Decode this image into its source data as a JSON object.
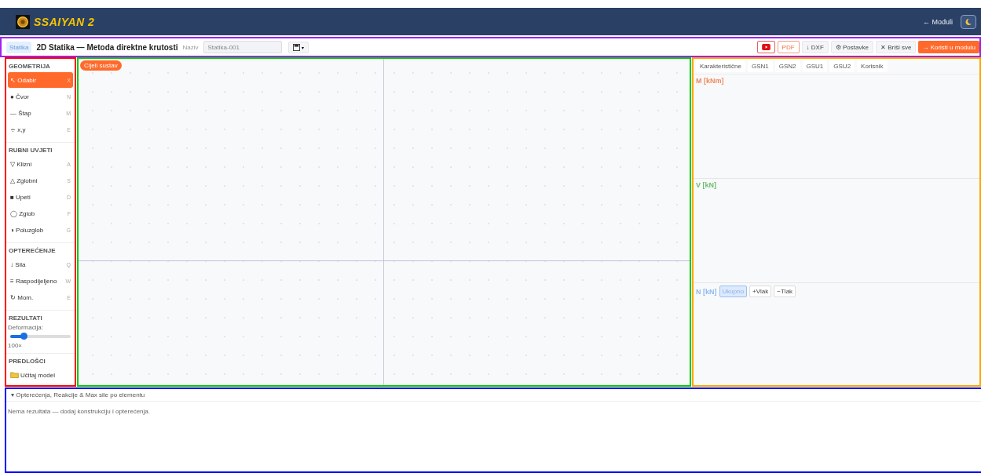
{
  "header": {
    "brand": "SSAIYAN 2",
    "back_link": "← Moduli"
  },
  "toolbar": {
    "tag": "Statika",
    "title": "2D Statika — Metoda direktne krutosti",
    "name_label": "Naziv",
    "name_value": "Statika-001",
    "save_caret": "▾",
    "buttons": [
      {
        "kind": "video"
      },
      {
        "kind": "outline",
        "label": "PDF"
      },
      {
        "kind": "plain",
        "label": "↓ DXF"
      },
      {
        "kind": "plain",
        "label": "⚙ Postavke"
      },
      {
        "kind": "plain",
        "label": "✕ Briši sve"
      },
      {
        "kind": "primary",
        "label": "→ Koristi u modulu"
      }
    ]
  },
  "sidebar": {
    "sections": [
      {
        "title": "GEOMETRIJA",
        "items": [
          {
            "icon": "↖",
            "label": "Odabir",
            "key": "X",
            "selected": true
          },
          {
            "icon": "●",
            "label": "Čvor",
            "key": "N",
            "selected": false
          },
          {
            "icon": "—",
            "label": "Štap",
            "key": "M",
            "selected": false
          },
          {
            "icon": "∻",
            "label": "x,y",
            "key": "E",
            "selected": false
          }
        ]
      },
      {
        "title": "RUBNI UVJETI",
        "items": [
          {
            "icon": "▽",
            "label": "Klizni",
            "key": "A",
            "selected": false
          },
          {
            "icon": "△",
            "label": "Zglobni",
            "key": "S",
            "selected": false
          },
          {
            "icon": "■",
            "label": "Upeti",
            "key": "D",
            "selected": false
          },
          {
            "icon": "◯",
            "label": "Zglob",
            "key": "F",
            "selected": false
          },
          {
            "icon": "◑",
            "label": "Poluzglob",
            "key": "G",
            "selected": false
          }
        ]
      },
      {
        "title": "OPTEREĆENJE",
        "items": [
          {
            "icon": "↓",
            "label": "Sila",
            "key": "Q",
            "selected": false
          },
          {
            "icon": "≡",
            "label": "Raspodijeljeno",
            "key": "W",
            "selected": false
          },
          {
            "icon": "↻",
            "label": "Mom.",
            "key": "E",
            "selected": false
          }
        ]
      }
    ],
    "results": {
      "title": "REZULTATI",
      "label": "Deformacija:",
      "level": 0.22,
      "reading": "100×"
    },
    "templates": {
      "title": "PREDLOŠCI",
      "button": "Učitaj model"
    }
  },
  "canvas": {
    "badge": "Cijeli sustav"
  },
  "diagrams": {
    "tabs": [
      {
        "label": "Karakteristične",
        "selected": false
      },
      {
        "label": "GSN1",
        "selected": false
      },
      {
        "label": "GSN2",
        "selected": false
      },
      {
        "label": "GSU1",
        "selected": false
      },
      {
        "label": "GSU2",
        "selected": false
      },
      {
        "label": "Korisnik",
        "selected": false
      }
    ],
    "panels": [
      {
        "label": "M [kNm]",
        "color": "#f08a5d"
      },
      {
        "label": "V [kN]",
        "color": "#6cbf6c"
      },
      {
        "label": "N [kN]",
        "color": "#8fb8ef",
        "toggles": [
          {
            "label": "Ukupno",
            "selected": true
          },
          {
            "label": "+Vlak",
            "selected": false
          },
          {
            "label": "−Tlak",
            "selected": false
          }
        ]
      }
    ]
  },
  "results_panel": {
    "title": "Opterećenja, Reakcije & Max sile po elementu",
    "caret": "▾",
    "empty": "Nema rezultata — dodaj konstrukciju i opterećenja."
  }
}
